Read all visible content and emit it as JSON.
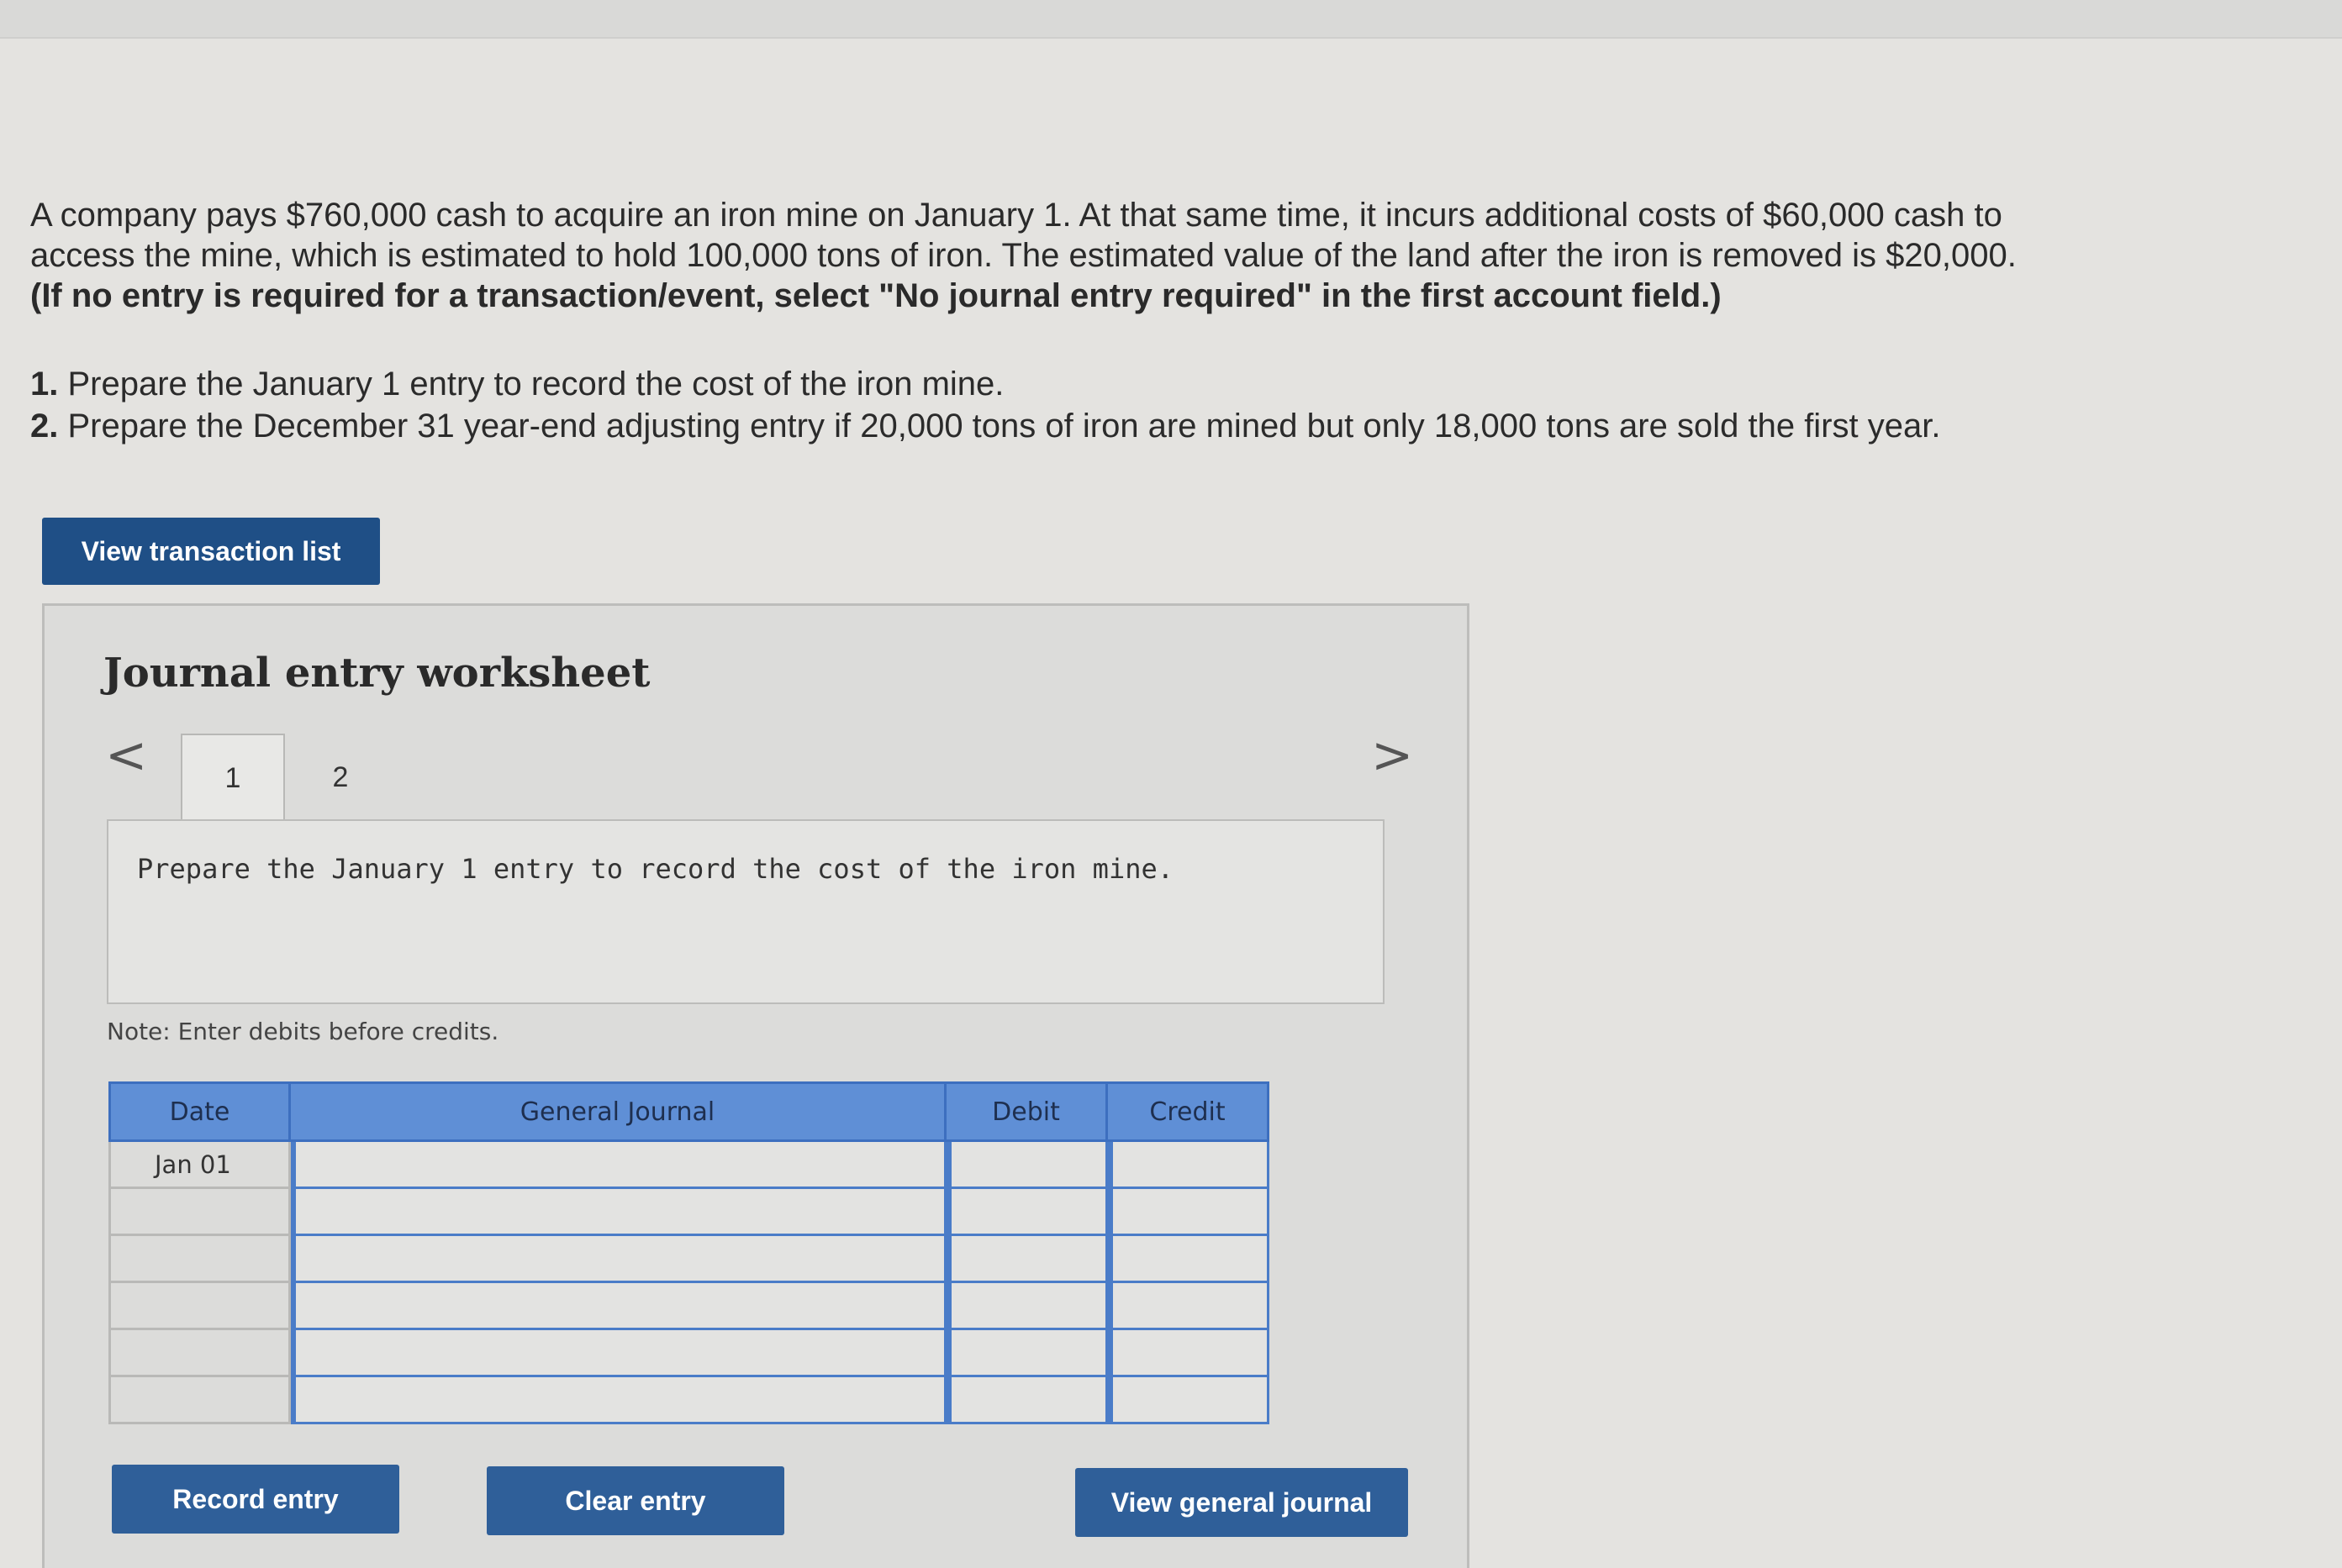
{
  "problem": {
    "line1": "A company pays $760,000 cash to acquire an iron mine on January 1. At that same time, it incurs additional costs of $60,000 cash to",
    "line2": "access the mine, which is estimated to hold 100,000 tons of iron. The estimated value of the land after the iron is removed is $20,000.",
    "instruction": "(If no entry is required for a transaction/event, select \"No journal entry required\" in the first account field.)"
  },
  "tasks": [
    {
      "num": "1.",
      "text": "Prepare the January 1 entry to record the cost of the iron mine."
    },
    {
      "num": "2.",
      "text": "Prepare the December 31 year-end adjusting entry if 20,000 tons of iron are mined but only 18,000 tons are sold the first year."
    }
  ],
  "buttons": {
    "view_transaction_list": "View transaction list",
    "record_entry": "Record entry",
    "clear_entry": "Clear entry",
    "view_general_journal": "View general journal"
  },
  "worksheet": {
    "title": "Journal entry worksheet",
    "nav_prev": "<",
    "nav_next": ">",
    "tabs": [
      "1",
      "2"
    ],
    "prompt": "Prepare the January 1 entry to record the cost of the iron mine.",
    "note": "Note: Enter debits before credits."
  },
  "journal": {
    "headers": {
      "date": "Date",
      "general_journal": "General Journal",
      "debit": "Debit",
      "credit": "Credit"
    },
    "rows": [
      {
        "date": "Jan 01",
        "account": "",
        "debit": "",
        "credit": ""
      },
      {
        "date": "",
        "account": "",
        "debit": "",
        "credit": ""
      },
      {
        "date": "",
        "account": "",
        "debit": "",
        "credit": ""
      },
      {
        "date": "",
        "account": "",
        "debit": "",
        "credit": ""
      },
      {
        "date": "",
        "account": "",
        "debit": "",
        "credit": ""
      },
      {
        "date": "",
        "account": "",
        "debit": "",
        "credit": ""
      }
    ]
  },
  "colors": {
    "button_blue": "#2f5f99",
    "header_blue": "#5f8fd6",
    "grid_blue": "#4a7cc8"
  }
}
